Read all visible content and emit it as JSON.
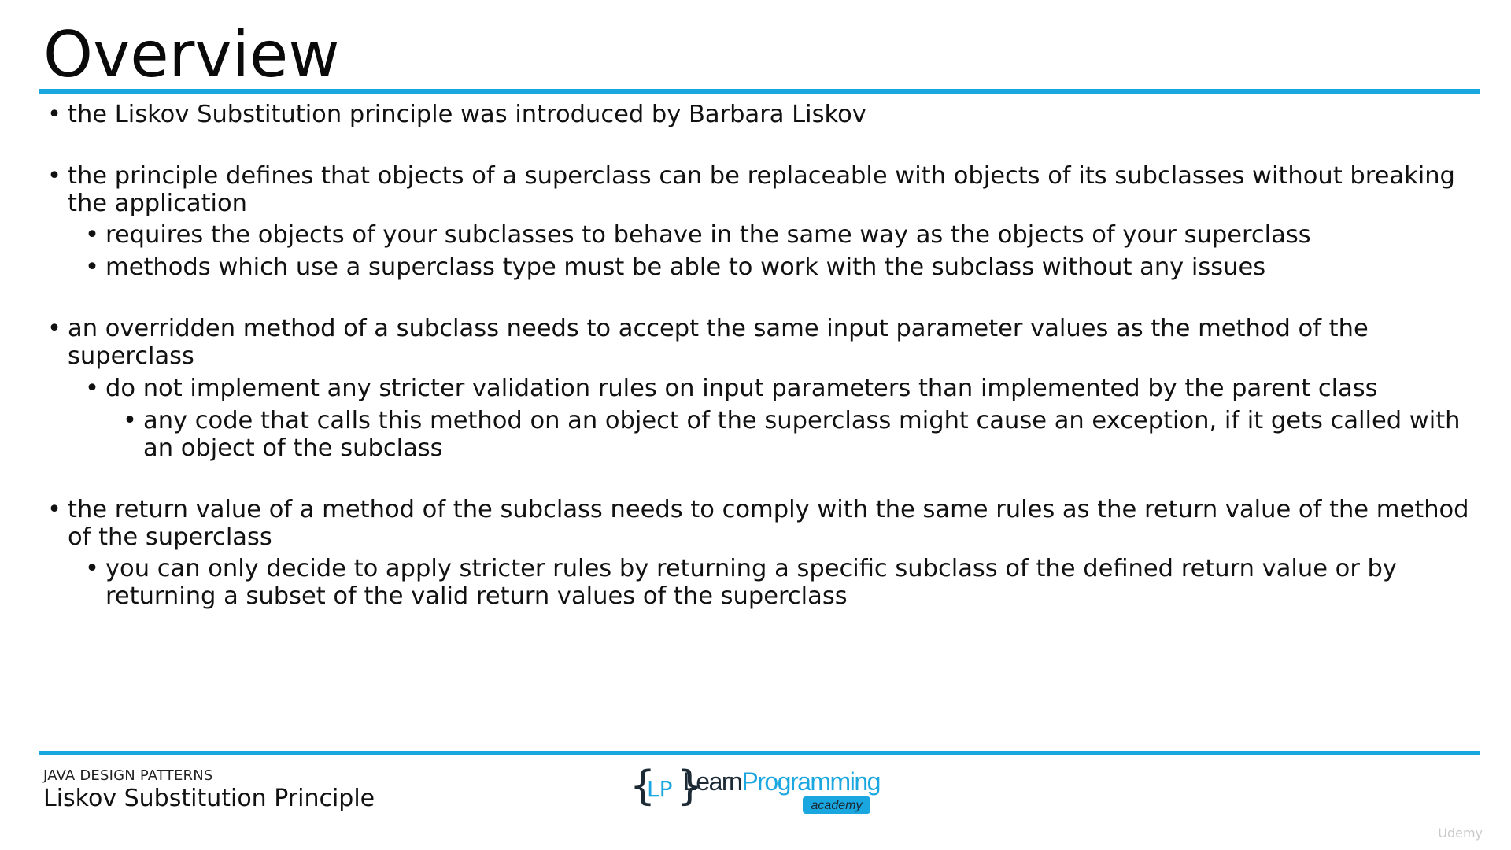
{
  "slide": {
    "title": "Overview",
    "accent_color": "#1aa6df"
  },
  "bullets": [
    {
      "level": 1,
      "text": "the Liskov Substitution principle was introduced by Barbara Liskov",
      "gap_before": 0
    },
    {
      "level": 1,
      "text": "the principle defines that objects of a superclass can be replaceable with objects of its subclasses without breaking the application",
      "gap_before": 1
    },
    {
      "level": 2,
      "text": "requires the objects of your subclasses to behave in the same way as the objects of your superclass",
      "gap_before": 0
    },
    {
      "level": 2,
      "text": "methods which use a superclass type must be able to work with the subclass without any issues",
      "gap_before": 0
    },
    {
      "level": 1,
      "text": "an overridden method of a subclass needs to accept the same input parameter values as the method of the superclass",
      "gap_before": 1
    },
    {
      "level": 2,
      "text": "do not implement any stricter validation rules on input parameters than implemented by the parent class",
      "gap_before": 0
    },
    {
      "level": 3,
      "text": "any code that calls this method on an object of the superclass might cause an exception, if it gets called with an object of the subclass",
      "gap_before": 0
    },
    {
      "level": 1,
      "text": "the return value of a method of the subclass needs to comply with the same rules as the return value of the method of the superclass",
      "gap_before": 1
    },
    {
      "level": 2,
      "text": "you can only decide to apply stricter rules by returning a specific subclass of the defined return value or by returning a subset of the valid return values of the superclass",
      "gap_before": 0
    }
  ],
  "footer": {
    "course": "JAVA DESIGN PATTERNS",
    "topic": "Liskov Substitution Principle"
  },
  "logo": {
    "mark": "LP",
    "name_part1": "Learn",
    "name_part2": "Programming",
    "tagline": "academy",
    "dark_color": "#1b2a35",
    "accent_color": "#1aa6df"
  },
  "watermark": {
    "text": "Udemy"
  }
}
